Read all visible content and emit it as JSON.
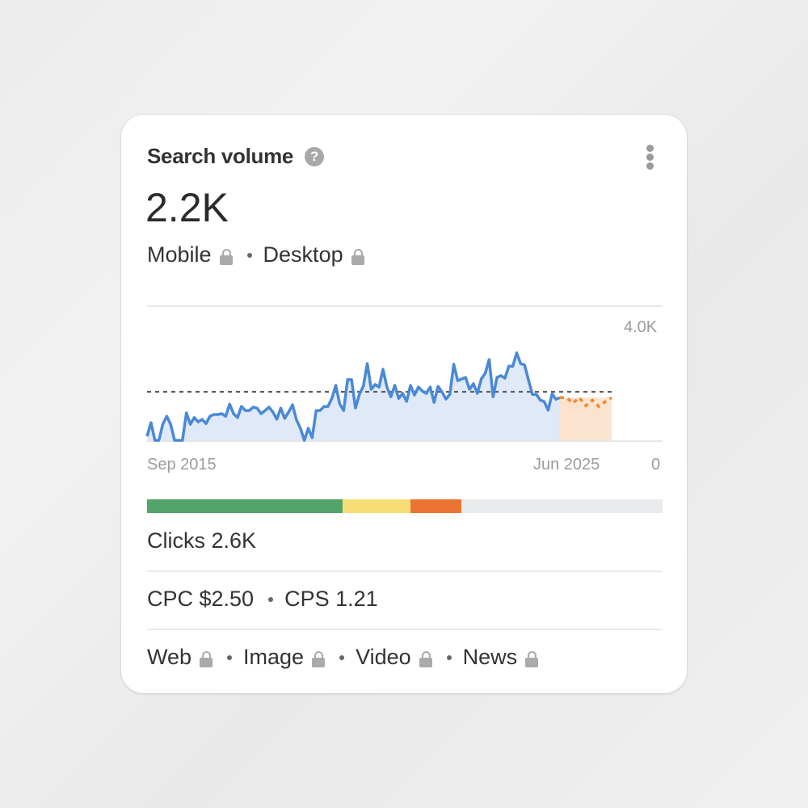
{
  "card": {
    "title": "Search volume",
    "help_icon": "question-circle-icon",
    "menu_icon": "more-vertical-icon",
    "value": "2.2K",
    "devices": [
      {
        "label": "Mobile",
        "locked": true
      },
      {
        "label": "Desktop",
        "locked": true
      }
    ],
    "difficulty_bar": {
      "segments": [
        {
          "name": "green",
          "color": "#52a46b",
          "fraction": 0.379
        },
        {
          "name": "yellow",
          "color": "#f7dd76",
          "fraction": 0.132
        },
        {
          "name": "orange",
          "color": "#eb7433",
          "fraction": 0.099
        }
      ],
      "track_color": "#e9eaec"
    },
    "clicks": "Clicks 2.6K",
    "cpc": "CPC $2.50",
    "cps": "CPS 1.21",
    "search_types": [
      {
        "label": "Web",
        "locked": true
      },
      {
        "label": "Image",
        "locked": true
      },
      {
        "label": "Video",
        "locked": true
      },
      {
        "label": "News",
        "locked": true
      }
    ]
  },
  "chart_data": {
    "type": "area",
    "title": "",
    "xlabel": "",
    "ylabel": "",
    "x_start_label": "Sep 2015",
    "x_end_label": "Jun 2025",
    "y_tick_labels": [
      "4.0K",
      "0"
    ],
    "ylim": [
      0,
      4000
    ],
    "grid": true,
    "average_line": 1450,
    "colors": {
      "actual_line": "#4a89d6",
      "actual_fill": "#dbe7f6",
      "forecast_line": "#f08a2c",
      "forecast_fill": "#fbe3cf",
      "average_line": "#555555"
    },
    "series": [
      {
        "name": "Search volume",
        "values": [
          120,
          530,
          0,
          0,
          480,
          720,
          480,
          0,
          0,
          0,
          820,
          480,
          680,
          550,
          625,
          500,
          720,
          770,
          770,
          795,
          720,
          1080,
          795,
          680,
          1010,
          890,
          890,
          990,
          960,
          795,
          890,
          990,
          845,
          630,
          960,
          655,
          845,
          1060,
          610,
          360,
          0,
          360,
          80,
          890,
          890,
          1010,
          1010,
          1250,
          1640,
          1085,
          890,
          1810,
          1810,
          965,
          1375,
          1615,
          2290,
          1520,
          1665,
          1590,
          2120,
          1590,
          1300,
          1640,
          1250,
          1400,
          1160,
          1640,
          1350,
          1590,
          1470,
          1400,
          1590,
          1130,
          1610,
          1445,
          1230,
          1370,
          2270,
          1780,
          1830,
          1875,
          1520,
          1690,
          1400,
          1830,
          2000,
          2410,
          1300,
          1880,
          1930,
          1855,
          2210,
          2210,
          2610,
          2290,
          2250,
          1800,
          1370,
          1370,
          1200,
          1155,
          900,
          1390,
          1225,
          1275
        ],
        "dates": "monthly, Sep 2015 – Jun 2025"
      },
      {
        "name": "Forecast",
        "values": [
          1275,
          1275,
          1110,
          1275,
          1035,
          1200,
          1010,
          1155,
          1275
        ]
      }
    ]
  }
}
